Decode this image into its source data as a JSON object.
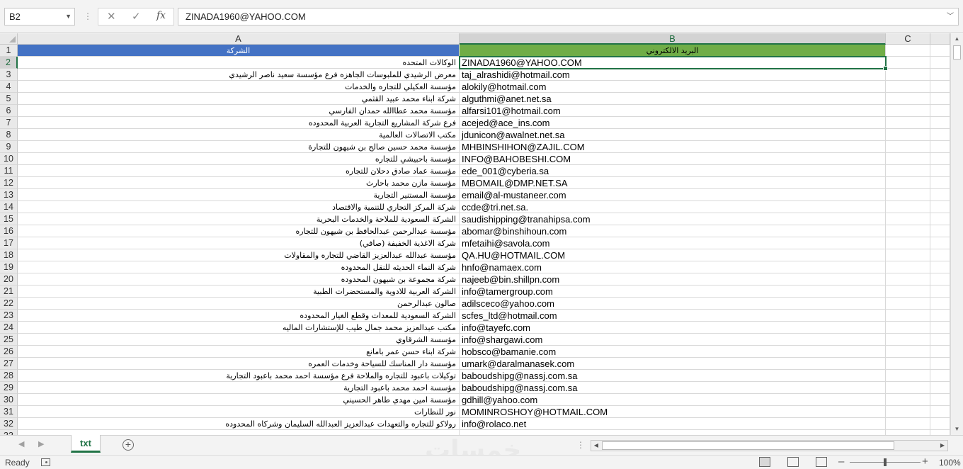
{
  "formula_bar": {
    "name_box": "B2",
    "cancel_glyph": "✕",
    "enter_glyph": "✓",
    "function_glyph": "fx",
    "value": "ZINADA1960@YAHOO.COM"
  },
  "columns": [
    "A",
    "B",
    "C"
  ],
  "rows": [
    {
      "n": "1",
      "a": "الشركة",
      "b": "البريد الالكتروني"
    },
    {
      "n": "2",
      "a": "الوكالات المتحده",
      "b": "ZINADA1960@YAHOO.COM"
    },
    {
      "n": "3",
      "a": "معرض الرشيدي للملبوسات الجاهزه فرع مؤسسة سعيد ناصر الرشيدي",
      "b": "taj_alrashidi@hotmail.com"
    },
    {
      "n": "4",
      "a": "مؤسسة العكيلي للتجاره والخدمات",
      "b": "alokily@hotmail.com"
    },
    {
      "n": "5",
      "a": "شركة ابناء محمد عبيد القثمي",
      "b": "alguthmi@anet.net.sa"
    },
    {
      "n": "6",
      "a": "مؤسسة محمد عطاالله حمدان الفارسي",
      "b": "alfarsi101@hotmail.com"
    },
    {
      "n": "7",
      "a": "فرع شركة المشاريع التجارية العربية المحدوده",
      "b": "acejed@ace_ins.com"
    },
    {
      "n": "8",
      "a": "مكتب الاتصالات العالمية",
      "b": "jdunicon@awalnet.net.sa"
    },
    {
      "n": "9",
      "a": "مؤسسة محمد حسين صالح بن شيهون للتجارة",
      "b": "MHBINSHIHON@ZAJIL.COM"
    },
    {
      "n": "10",
      "a": "مؤسسة باحبيشي للتجاره",
      "b": "INFO@BAHOBESHI.COM"
    },
    {
      "n": "11",
      "a": "مؤسسة عماد صادق دحلان للتجاره",
      "b": "ede_001@cyberia.sa"
    },
    {
      "n": "12",
      "a": "مؤسسة مازن محمد باحارث",
      "b": "MBOMAIL@DMP.NET.SA"
    },
    {
      "n": "13",
      "a": "مؤسسة المستنير التجارية",
      "b": "email@al-mustaneer.com"
    },
    {
      "n": "14",
      "a": "شركة المركز التجاري للتنمية والاقتصاد",
      "b": "ccde@tri.net.sa."
    },
    {
      "n": "15",
      "a": "الشركة السعودية للملاحة والخدمات البحرية",
      "b": "saudishipping@tranahipsa.com"
    },
    {
      "n": "16",
      "a": "مؤسسة عبدالرحمن عبدالحافظ بن شيهون للتجاره",
      "b": "abomar@binshihoun.com"
    },
    {
      "n": "17",
      "a": "شركة الاغذية الخفيفة (صافي)",
      "b": "mfetaihi@savola.com"
    },
    {
      "n": "18",
      "a": "مؤسسة عبدالله عبدالعزيز القاضي للتجاره والمقاولات",
      "b": "QA.HU@HOTMAIL.COM"
    },
    {
      "n": "19",
      "a": "شركة النماء الحديثه للنقل المحدوده",
      "b": "hnfo@namaex.com"
    },
    {
      "n": "20",
      "a": "شركة مجموعة بن شيهون المحدوده",
      "b": "najeeb@bin.shillpn.com"
    },
    {
      "n": "21",
      "a": "الشركة العربية للادوية والمستحضرات الطبية",
      "b": "info@tamergroup.com"
    },
    {
      "n": "22",
      "a": "صالون عبدالرحمن",
      "b": "adilsceco@yahoo.com"
    },
    {
      "n": "23",
      "a": "الشركة السعودية للمعدات وقطع الغيار المحدوده",
      "b": "scfes_ltd@hotmail.com"
    },
    {
      "n": "24",
      "a": "مكتب عبدالعزيز محمد جمال طيب للإستشارات الماليه",
      "b": "info@tayefc.com"
    },
    {
      "n": "25",
      "a": "مؤسسة الشرقاوي",
      "b": "info@shargawi.com"
    },
    {
      "n": "26",
      "a": "شركة ابناء حسن عمر بامانع",
      "b": "hobsco@bamanie.com"
    },
    {
      "n": "27",
      "a": "مؤسسة دار المناسك للسياحة وخدمات العمره",
      "b": "umark@daralmanasek.com"
    },
    {
      "n": "28",
      "a": "توكيلات باعبود للتجاره والملاحة فرع مؤسسة احمد محمد باعبود التجارية",
      "b": "baboudshipg@nassj.com.sa"
    },
    {
      "n": "29",
      "a": "مؤسسة احمد محمد باعبود التجارية",
      "b": "baboudshipg@nassj.com.sa"
    },
    {
      "n": "30",
      "a": "مؤسسة امين مهدي طاهر الحسيني",
      "b": "gdhill@yahoo.com"
    },
    {
      "n": "31",
      "a": "نور للنظارات",
      "b": "MOMINROSHOY@HOTMAIL.COM"
    },
    {
      "n": "32",
      "a": "رولاكو للتجاره والتعهدات عبدالعزيز العبدالله السليمان وشركاه المحدوده",
      "b": "info@rolaco.net"
    },
    {
      "n": "33",
      "a": "",
      "b": ""
    }
  ],
  "sheet_tabs": {
    "active": "txt",
    "prev_glyph": "◀",
    "next_glyph": "▶",
    "add_glyph": "+",
    "dots_glyph": "⋮"
  },
  "watermark": "خمسات",
  "status_bar": {
    "ready": "Ready",
    "zoom_minus": "–",
    "zoom_plus": "+",
    "zoom_level": "100%",
    "zoom_fraction": 0.5
  },
  "colors": {
    "header_a_fill": "#4472c4",
    "header_b_fill": "#70ad47",
    "accent": "#217346"
  },
  "icons": [
    "dropdown-icon",
    "cancel-icon",
    "enter-icon",
    "function-icon",
    "scroll-up-icon",
    "scroll-down-icon",
    "scroll-left-icon",
    "scroll-right-icon",
    "add-sheet-icon",
    "macro-record-icon",
    "normal-view-icon",
    "page-layout-icon",
    "page-break-icon"
  ]
}
